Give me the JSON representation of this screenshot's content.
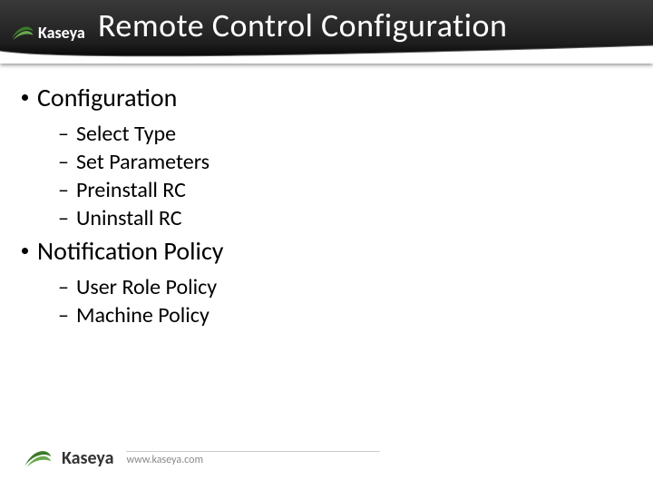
{
  "brand": "Kaseya",
  "title": "Remote Control Configuration",
  "footer_url": "www.kaseya.com",
  "bullets": [
    {
      "label": "Configuration",
      "items": [
        "Select Type",
        "Set Parameters",
        "Preinstall RC",
        "Uninstall RC"
      ]
    },
    {
      "label": "Notification Policy",
      "items": [
        "User Role Policy",
        "Machine Policy"
      ]
    }
  ]
}
